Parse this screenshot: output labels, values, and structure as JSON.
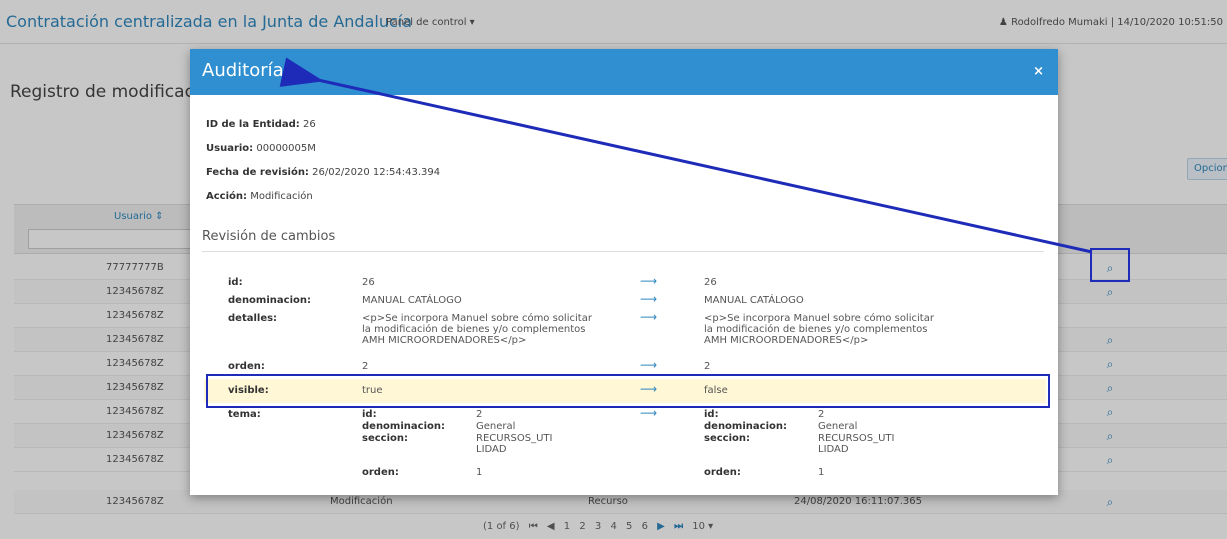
{
  "header": {
    "app_title": "Contratación centralizada en la Junta de Andalucía",
    "panel_menu": "Panel de control ▾",
    "user_info": "♟ Rodolfredo Mumaki | 14/10/2020 10:51:50"
  },
  "page": {
    "heading": "Registro de modificacio",
    "opciones_button": "Opciones ▾"
  },
  "table": {
    "column_usuario": "Usuario ⇕",
    "rows": [
      {
        "usuario": "77777777B"
      },
      {
        "usuario": "12345678Z"
      },
      {
        "usuario": "12345678Z"
      },
      {
        "usuario": "12345678Z"
      },
      {
        "usuario": "12345678Z"
      },
      {
        "usuario": "12345678Z"
      },
      {
        "usuario": "12345678Z"
      },
      {
        "usuario": "12345678Z"
      },
      {
        "usuario": "12345678Z"
      },
      {
        "usuario": "12345678Z",
        "accion": "Modificación",
        "tipo": "Recurso",
        "fecha": "24/08/2020 16:11:07.365"
      }
    ],
    "view_icon": "search-icon"
  },
  "pager": {
    "summary": "(1 of 6)",
    "first": "⏮",
    "prev": "◀",
    "pages": [
      "1",
      "2",
      "3",
      "4",
      "5",
      "6"
    ],
    "next": "▶",
    "last": "⏭",
    "per_page": "10 ▾"
  },
  "modal": {
    "title": "Auditoría",
    "close": "×",
    "entity_label": "ID de la Entidad:",
    "entity_value": " 26",
    "user_label": "Usuario:",
    "user_value": " 00000005M",
    "date_label": "Fecha de revisión:",
    "date_value": " 26/02/2020 12:54:43.394",
    "action_label": "Acción:",
    "action_value": " Modificación",
    "section_title": "Revisión de cambios",
    "arrow": "⟶",
    "fields": {
      "id": {
        "label": "id:",
        "old": "26",
        "new": "26"
      },
      "denominacion": {
        "label": "denominacion:",
        "old": "MANUAL CATÁLOGO",
        "new": "MANUAL CATÁLOGO"
      },
      "detalles": {
        "label": "detalles:",
        "old": [
          "<p>Se incorpora Manuel sobre cómo solicitar",
          "la modificación de bienes y/o complementos",
          "AMH MICROORDENADORES</p>"
        ],
        "new": [
          "<p>Se incorpora Manuel sobre cómo solicitar",
          "la modificación de bienes y/o complementos",
          "AMH MICROORDENADORES</p>"
        ]
      },
      "orden": {
        "label": "orden:",
        "old": "2",
        "new": "2"
      },
      "visible": {
        "label": "visible:",
        "old": "true",
        "new": "false"
      },
      "tema": {
        "label": "tema:",
        "id_label": "id:",
        "id_value": "2",
        "denominacion_label": "denominacion:",
        "denominacion_value": "General",
        "seccion_label": "seccion:",
        "seccion_value_1": "RECURSOS_UTI",
        "seccion_value_2": "LIDAD",
        "orden_label": "orden:",
        "orden_value": "1"
      }
    }
  },
  "colors": {
    "modal_header": "#2f8fd0",
    "link_blue": "#2f88bf",
    "annotation_blue": "#1e2bb8",
    "highlight_row": "#fff7d6"
  }
}
